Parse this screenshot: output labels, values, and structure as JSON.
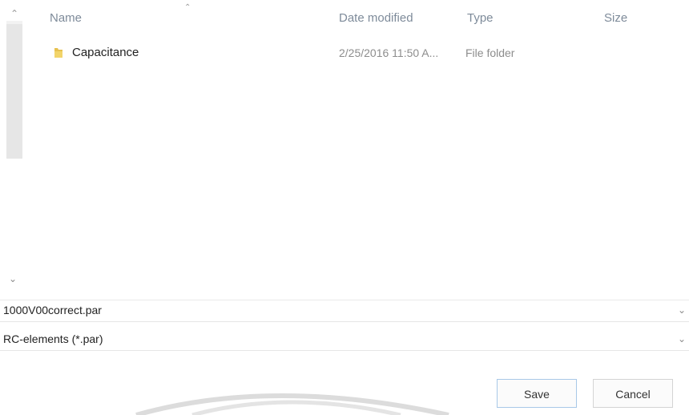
{
  "columns": {
    "name": "Name",
    "date_modified": "Date modified",
    "type": "Type",
    "size": "Size"
  },
  "files": [
    {
      "name": "Capacitance",
      "date": "2/25/2016 11:50 A...",
      "type": "File folder",
      "icon": "folder-icon"
    }
  ],
  "file_name_field": {
    "value": "1000V00correct.par"
  },
  "file_type_filter": {
    "value": "RC-elements (*.par)"
  },
  "buttons": {
    "save": "Save",
    "cancel": "Cancel"
  },
  "colors": {
    "folder": "#e7c14f",
    "header_text": "#7e8b9a",
    "save_border": "#a8c8e8"
  }
}
